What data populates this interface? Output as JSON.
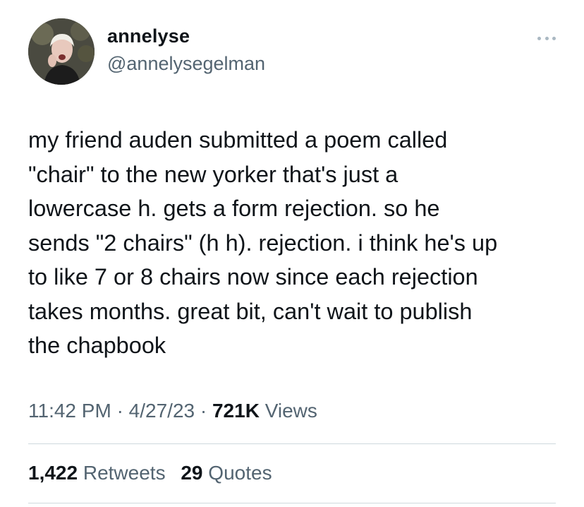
{
  "user": {
    "display_name": "annelyse",
    "handle": "@annelysegelman",
    "avatar_icon": "profile-photo"
  },
  "menu": {
    "icon": "more-horizontal-icon"
  },
  "tweet": {
    "text": "my friend auden submitted a poem called\n\"chair\" to the new yorker that's just a\nlowercase h. gets a form rejection. so he\nsends \"2 chairs\" (h h). rejection. i think he's up\nto like 7 or 8 chairs now since each rejection\ntakes months. great bit, can't wait to publish\nthe chapbook",
    "time": "11:42 PM",
    "date": "4/27/23",
    "separator": "·",
    "views_count": "721K",
    "views_label": "Views"
  },
  "stats": {
    "retweets_count": "1,422",
    "retweets_label": "Retweets",
    "quotes_count": "29",
    "quotes_label": "Quotes"
  },
  "colors": {
    "text_primary": "#0f1419",
    "text_secondary": "#536471",
    "divider": "#cfd9de",
    "background": "#ffffff"
  }
}
